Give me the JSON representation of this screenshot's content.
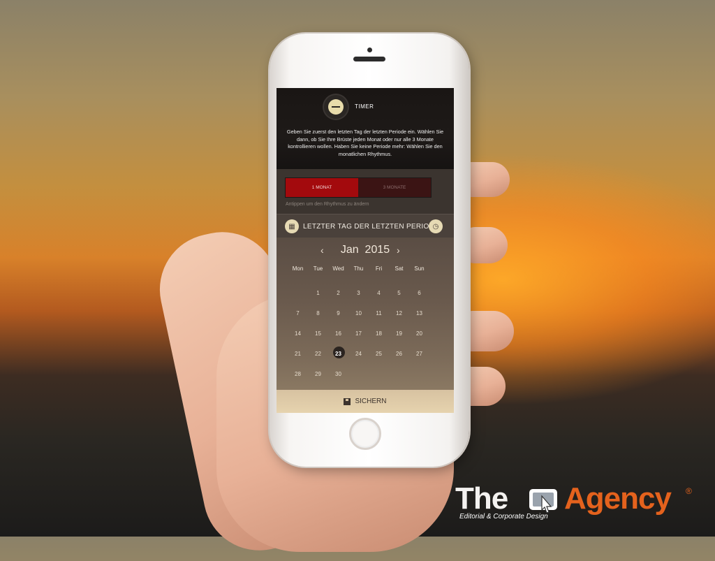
{
  "app": {
    "timer_label": "TIMER",
    "intro_text": "Geben Sie zuerst den letzten Tag der letzten Periode ein. Wählen Sie dann, ob Sie Ihre Brüste jeden Monat oder nur alle 3 Monate kontrollieren wollen. Haben Sie keine Periode mehr: Wählen Sie den monatlichen Rhythmus.",
    "rhythm": {
      "options": [
        "1 MONAT",
        "3 MONATE"
      ],
      "selected": "1 MONAT",
      "hint": "Antippen um den Rhythmus zu ändern"
    },
    "section_title": "LETZTER TAG DER LETZTEN PERIODE",
    "calendar": {
      "month": "Jan",
      "year": "2015",
      "prev_icon": "chevron-left-icon",
      "next_icon": "chevron-right-icon",
      "weekdays": [
        "Mon",
        "Tue",
        "Wed",
        "Thu",
        "Fri",
        "Sat",
        "Sun"
      ],
      "weeks": [
        [
          "",
          "1",
          "2",
          "3",
          "4",
          "5",
          "6"
        ],
        [
          "7",
          "8",
          "9",
          "10",
          "11",
          "12",
          "13"
        ],
        [
          "14",
          "15",
          "16",
          "17",
          "18",
          "19",
          "20"
        ],
        [
          "21",
          "22",
          "23",
          "24",
          "25",
          "26",
          "27"
        ],
        [
          "28",
          "29",
          "30",
          "",
          "",
          "",
          ""
        ]
      ],
      "selected_day": "23"
    },
    "save_label": "SICHERN",
    "colors": {
      "accent_red": "#a30a0d",
      "gold": "#e6dab4",
      "save_bar": "#e6d3ae"
    }
  },
  "logo": {
    "part1": "The",
    "part2": "Agency",
    "registered": "®",
    "tagline": "Editorial & Corporate Design",
    "colors": {
      "primary": "#f4f2f0",
      "accent": "#e4621d"
    }
  }
}
